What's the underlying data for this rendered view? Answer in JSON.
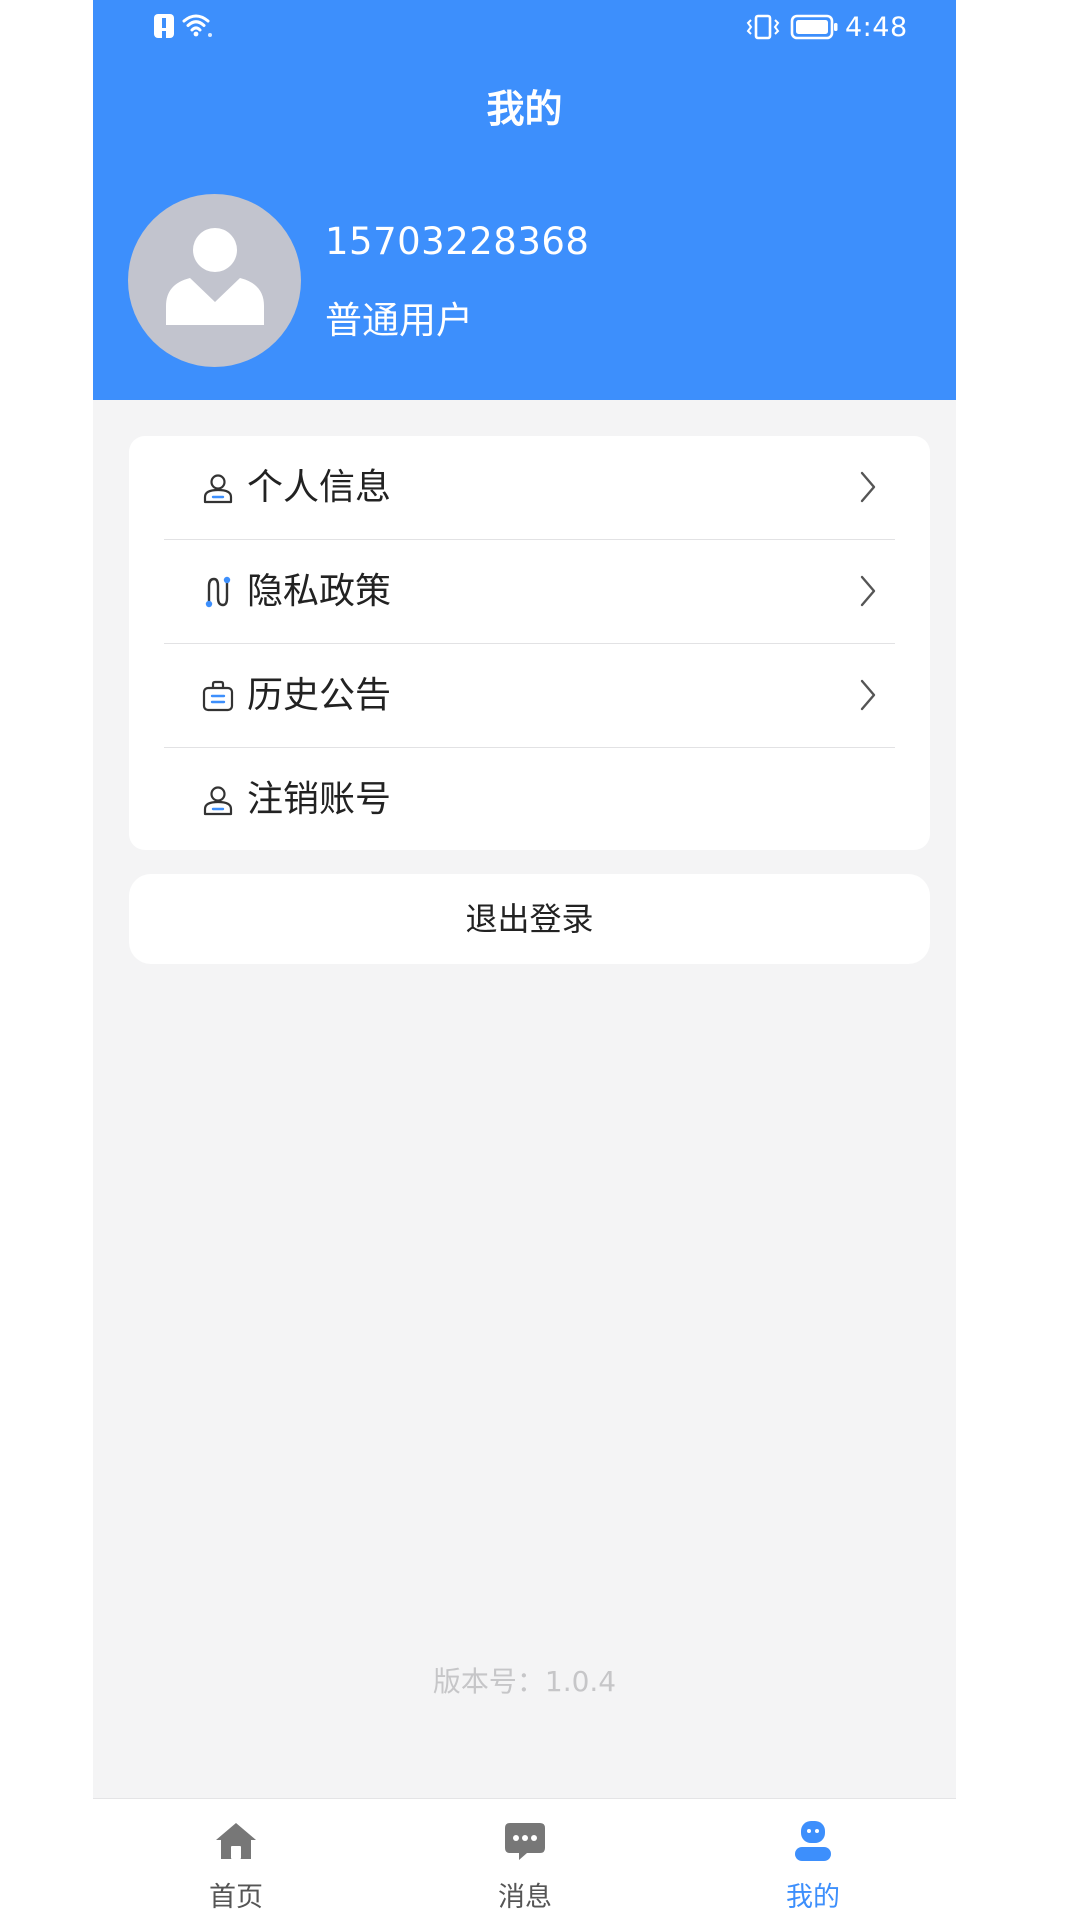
{
  "status_bar": {
    "time": "4:48",
    "icons": [
      "alert-icon",
      "wifi-icon",
      "vibrate-icon",
      "battery-icon"
    ]
  },
  "header": {
    "title": "我的"
  },
  "profile": {
    "avatar_icon": "user-avatar-icon",
    "phone": "15703228368",
    "role": "普通用户"
  },
  "menu": {
    "items": [
      {
        "label": "个人信息",
        "icon": "person-icon",
        "has_arrow": true
      },
      {
        "label": "隐私政策",
        "icon": "route-icon",
        "has_arrow": true
      },
      {
        "label": "历史公告",
        "icon": "notice-bag-icon",
        "has_arrow": true
      },
      {
        "label": "注销账号",
        "icon": "person-icon",
        "has_arrow": false
      }
    ]
  },
  "logout": {
    "label": "退出登录"
  },
  "footer": {
    "version": "版本号：1.0.4"
  },
  "tabs": [
    {
      "label": "首页",
      "icon": "home-icon",
      "active": false
    },
    {
      "label": "消息",
      "icon": "message-icon",
      "active": false
    },
    {
      "label": "我的",
      "icon": "profile-icon",
      "active": true
    }
  ],
  "colors": {
    "primary": "#3d8ffc",
    "background": "#f4f4f5",
    "avatar_bg": "#c2c4ce",
    "text": "#222222",
    "muted": "#c6c6c8"
  }
}
